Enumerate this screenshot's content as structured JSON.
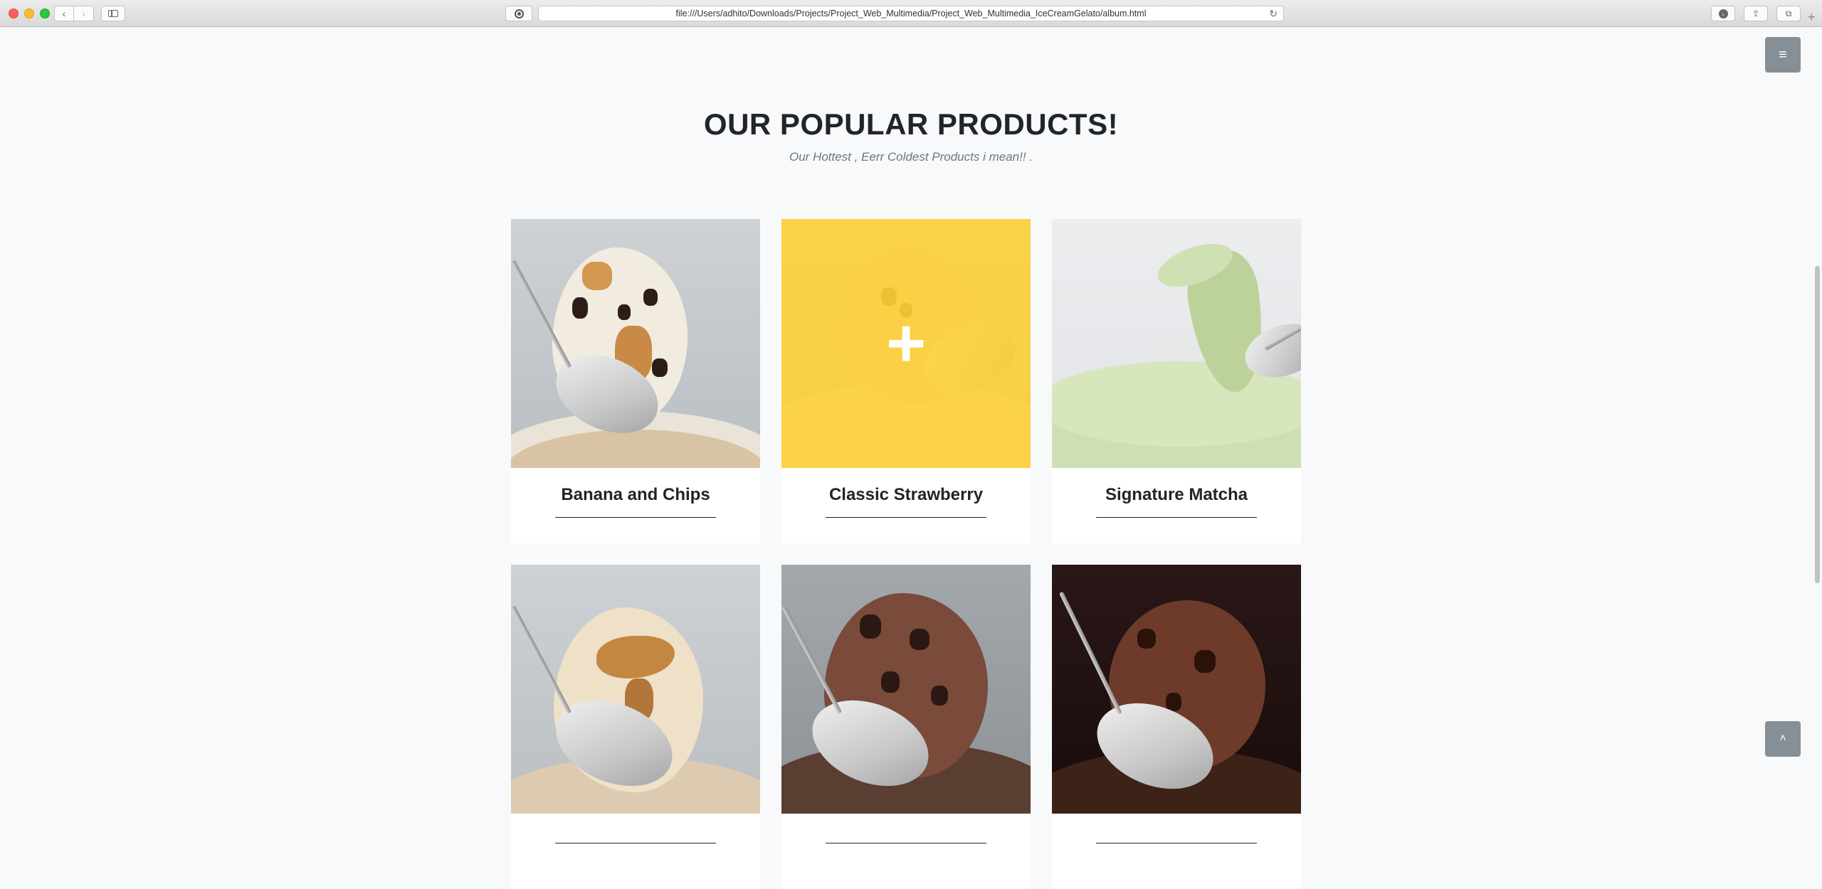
{
  "browser": {
    "url": "file:///Users/adhito/Downloads/Projects/Project_Web_Multimedia/Project_Web_Multimedia_IceCreamGelato/album.html",
    "icons": {
      "back": "chevron-left-icon",
      "forward": "chevron-right-icon",
      "sidebar": "sidebar-icon",
      "reader": "reader-icon",
      "reload": "reload-icon",
      "download": "download-icon",
      "share": "share-icon",
      "tabs": "tabs-icon",
      "new_tab": "plus-icon"
    }
  },
  "page": {
    "menu_button": "≡",
    "scroll_top_button": "˄",
    "section": {
      "title": "OUR POPULAR PRODUCTS!",
      "subtitle": "Our Hottest , Eerr Coldest Products i mean!! ."
    },
    "products": [
      {
        "name": "Banana and Chips",
        "hovered": false
      },
      {
        "name": "Classic Strawberry",
        "hovered": true,
        "overlay_icon": "+"
      },
      {
        "name": "Signature Matcha",
        "hovered": false
      },
      {
        "name": ""
      },
      {
        "name": ""
      },
      {
        "name": ""
      }
    ],
    "colors": {
      "background": "#f8f9fa",
      "heading": "#212529",
      "subtitle": "#6c757d",
      "hover_overlay": "#fed136",
      "floating_button": "#868e96"
    }
  }
}
